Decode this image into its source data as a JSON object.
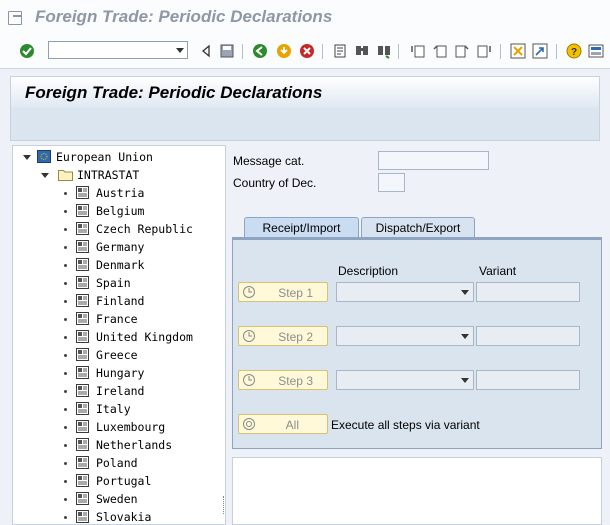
{
  "window": {
    "title": "Foreign Trade: Periodic Declarations"
  },
  "toolbar": {
    "command_field": {
      "value": "",
      "placeholder": ""
    },
    "icons": [
      "enter-checkmark-icon",
      "back-icon",
      "save-icon",
      "back-arrow-icon",
      "exit-icon",
      "cancel-icon",
      "print-icon",
      "find-icon",
      "find-next-icon",
      "first-page-icon",
      "previous-page-icon",
      "next-page-icon",
      "last-page-icon",
      "create-session-icon",
      "shortcut-icon",
      "help-icon",
      "layout-menu-icon"
    ]
  },
  "header": {
    "title": "Foreign Trade: Periodic Declarations"
  },
  "tree": {
    "root": {
      "label": "European Union",
      "icon": "eu-flag-icon"
    },
    "folder": {
      "label": "INTRASTAT",
      "icon": "folder-icon"
    },
    "countries": [
      "Austria",
      "Belgium",
      "Czech Republic",
      "Germany",
      "Denmark",
      "Spain",
      "Finland",
      "France",
      "United Kingdom",
      "Greece",
      "Hungary",
      "Ireland",
      "Italy",
      "Luxembourg",
      "Netherlands",
      "Poland",
      "Portugal",
      "Sweden",
      "Slovakia"
    ]
  },
  "form": {
    "message_cat_label": "Message cat.",
    "message_cat_value": "",
    "country_label": "Country of Dec.",
    "country_value": ""
  },
  "tabs": [
    {
      "label": "Receipt/Import",
      "active": true
    },
    {
      "label": "Dispatch/Export",
      "active": false
    }
  ],
  "steps": {
    "description_header": "Description",
    "variant_header": "Variant",
    "step1": "Step 1",
    "step2": "Step 2",
    "step3": "Step 3",
    "all_button": "All",
    "all_text": "Execute all steps via variant"
  },
  "colors": {
    "accent": "#8ea5c2",
    "button_bg": "#fff9d9",
    "panel_bg": "#d9e4ef"
  }
}
